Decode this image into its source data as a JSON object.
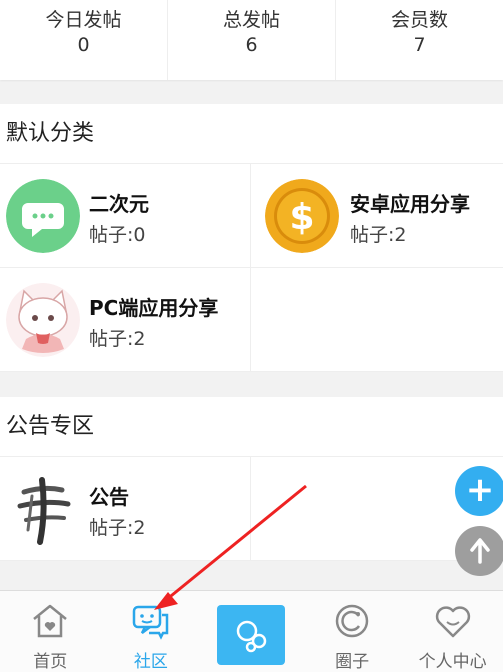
{
  "stats": [
    {
      "label": "今日发帖",
      "value": "0"
    },
    {
      "label": "总发帖",
      "value": "6"
    },
    {
      "label": "会员数",
      "value": "7"
    }
  ],
  "default_section": {
    "title": "默认分类",
    "items": [
      {
        "name": "二次元",
        "count": "帖子:0",
        "icon": "chat-bubble-icon"
      },
      {
        "name": "安卓应用分享",
        "count": "帖子:2",
        "icon": "dollar-coin-icon"
      },
      {
        "name": "PC端应用分享",
        "count": "帖子:2",
        "icon": "anime-cat-avatar"
      }
    ]
  },
  "announce_section": {
    "title": "公告专区",
    "items": [
      {
        "name": "公告",
        "count": "帖子:2",
        "icon": "calligraphy-icon"
      }
    ]
  },
  "fab": {
    "add": "+"
  },
  "nav": [
    {
      "label": "首页",
      "icon": "home-icon"
    },
    {
      "label": "社区",
      "icon": "community-chat-icon",
      "active": true
    },
    {
      "label": "",
      "icon": "bubbles-icon"
    },
    {
      "label": "圈子",
      "icon": "circle-icon"
    },
    {
      "label": "个人中心",
      "icon": "heart-face-icon"
    }
  ],
  "colors": {
    "accent": "#2aa6ea",
    "green": "#6bd08a",
    "gold": "#f0a91c"
  }
}
